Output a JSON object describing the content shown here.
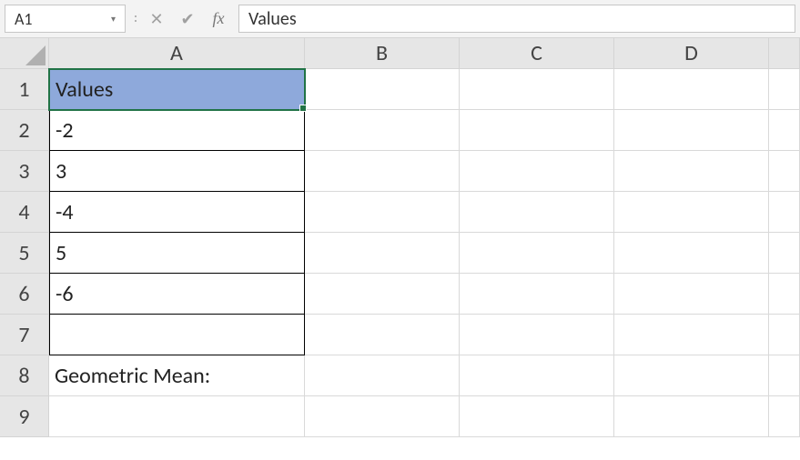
{
  "namebox": {
    "ref": "A1",
    "dropdown_icon": "▾"
  },
  "formula_bar": {
    "cancel_label": "✕",
    "confirm_label": "✔",
    "fx_label": "fx",
    "value": "Values"
  },
  "columns": [
    "A",
    "B",
    "C",
    "D"
  ],
  "rows": [
    "1",
    "2",
    "3",
    "4",
    "5",
    "6",
    "7",
    "8",
    "9"
  ],
  "cells": {
    "A1": "Values",
    "A2": "-2",
    "A3": "3",
    "A4": "-4",
    "A5": "5",
    "A6": "-6",
    "A7": "",
    "A8": "Geometric Mean:"
  },
  "selection": "A1"
}
